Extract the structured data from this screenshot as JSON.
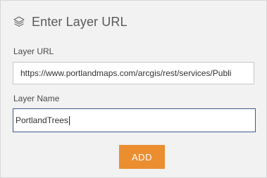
{
  "header": {
    "icon": "layers-icon",
    "title": "Enter Layer URL"
  },
  "form": {
    "url_label": "Layer URL",
    "url_value": "https://www.portlandmaps.com/arcgis/rest/services/Publi",
    "name_label": "Layer Name",
    "name_value": "PortlandTrees",
    "add_label": "ADD"
  },
  "colors": {
    "panel_bg": "#f2f2f2",
    "accent_button": "#ea8e30",
    "focus_border": "#3f5a8a"
  }
}
